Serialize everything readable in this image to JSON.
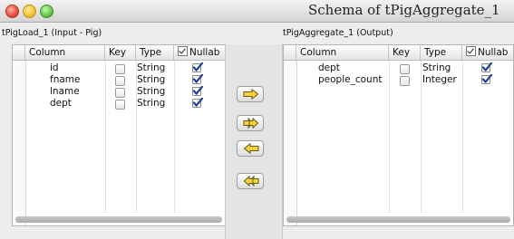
{
  "window": {
    "title": "Schema of tPigAggregate_1"
  },
  "input": {
    "label": "tPigLoad_1 (Input - Pig)",
    "headers": {
      "column": "Column",
      "key": "Key",
      "type": "Type",
      "nullable": "Nullab"
    },
    "rows": [
      {
        "column": "id",
        "type": "String",
        "key": false,
        "nullable": true
      },
      {
        "column": "fname",
        "type": "String",
        "key": false,
        "nullable": true
      },
      {
        "column": "lname",
        "type": "String",
        "key": false,
        "nullable": true
      },
      {
        "column": "dept",
        "type": "String",
        "key": false,
        "nullable": true
      }
    ]
  },
  "output": {
    "label": "tPigAggregate_1 (Output)",
    "headers": {
      "column": "Column",
      "key": "Key",
      "type": "Type",
      "nullable": "Nullab"
    },
    "rows": [
      {
        "column": "dept",
        "type": "String",
        "key": false,
        "nullable": true
      },
      {
        "column": "people_count",
        "type": "Integer",
        "key": false,
        "nullable": true
      }
    ]
  },
  "transfer_buttons": [
    {
      "icon": "arrow-right-icon"
    },
    {
      "icon": "double-arrow-right-icon"
    },
    {
      "icon": "arrow-left-icon"
    },
    {
      "icon": "double-arrow-left-icon"
    }
  ],
  "colors": {
    "checkmark": "#1f3f9e",
    "arrow_fill": "#f4d23a"
  }
}
